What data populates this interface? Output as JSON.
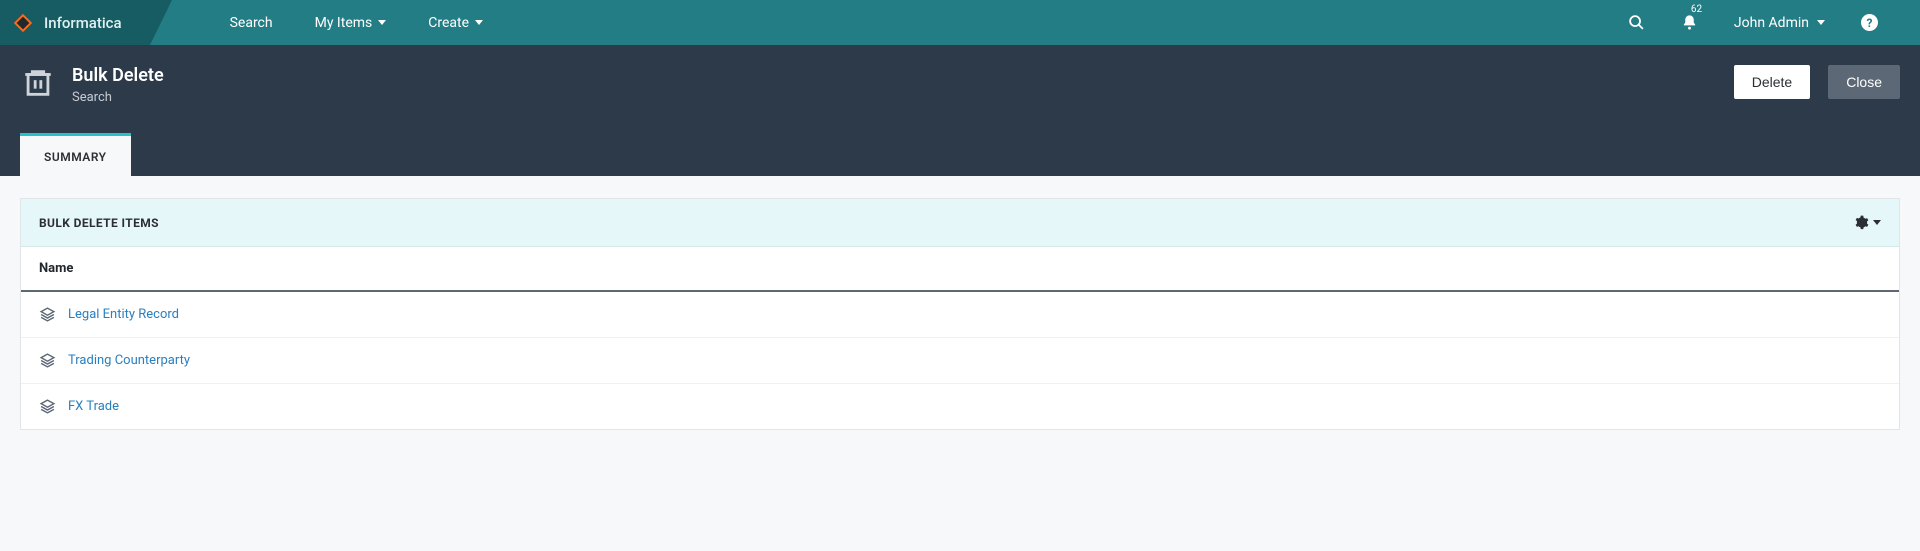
{
  "brand": {
    "name": "Informatica"
  },
  "topnav": {
    "search": "Search",
    "my_items": "My Items",
    "create": "Create"
  },
  "topright": {
    "notif_count": "62",
    "user_name": "John Admin"
  },
  "page_header": {
    "title": "Bulk Delete",
    "subtitle": "Search",
    "delete_label": "Delete",
    "close_label": "Close"
  },
  "tabs": {
    "summary": "SUMMARY"
  },
  "panel": {
    "title": "BULK DELETE ITEMS",
    "column_name": "Name",
    "rows": [
      {
        "name": "Legal Entity Record"
      },
      {
        "name": "Trading Counterparty"
      },
      {
        "name": "FX Trade"
      }
    ]
  }
}
